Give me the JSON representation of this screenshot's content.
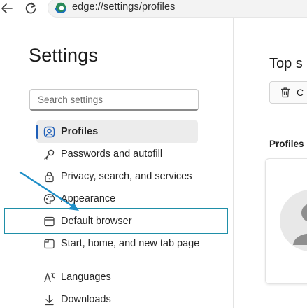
{
  "address_bar": {
    "url": "edge://settings/profiles"
  },
  "settings": {
    "title": "Settings",
    "search_placeholder": "Search settings",
    "menu": [
      {
        "label": "Profiles",
        "icon": "profiles-icon",
        "selected": true
      },
      {
        "label": "Passwords and autofill",
        "icon": "key-icon",
        "selected": false
      },
      {
        "label": "Privacy, search, and services",
        "icon": "lock-icon",
        "selected": false
      },
      {
        "label": "Appearance",
        "icon": "palette-icon",
        "selected": false
      },
      {
        "label": "Default browser",
        "icon": "browser-window-icon",
        "selected": false
      },
      {
        "label": "Start, home, and new tab page",
        "icon": "home-tab-icon",
        "selected": false
      },
      {
        "label": "Languages",
        "icon": "languages-icon",
        "selected": false
      },
      {
        "label": "Downloads",
        "icon": "download-icon",
        "selected": false
      }
    ]
  },
  "right_panel": {
    "title": "Top s",
    "button_label": "C",
    "section_label": "Profiles"
  },
  "colors": {
    "accent": "#1f5fb8",
    "highlight_box": "#1f8fa8",
    "arrow": "#1f8fc8",
    "selected_bg": "#ececec"
  }
}
